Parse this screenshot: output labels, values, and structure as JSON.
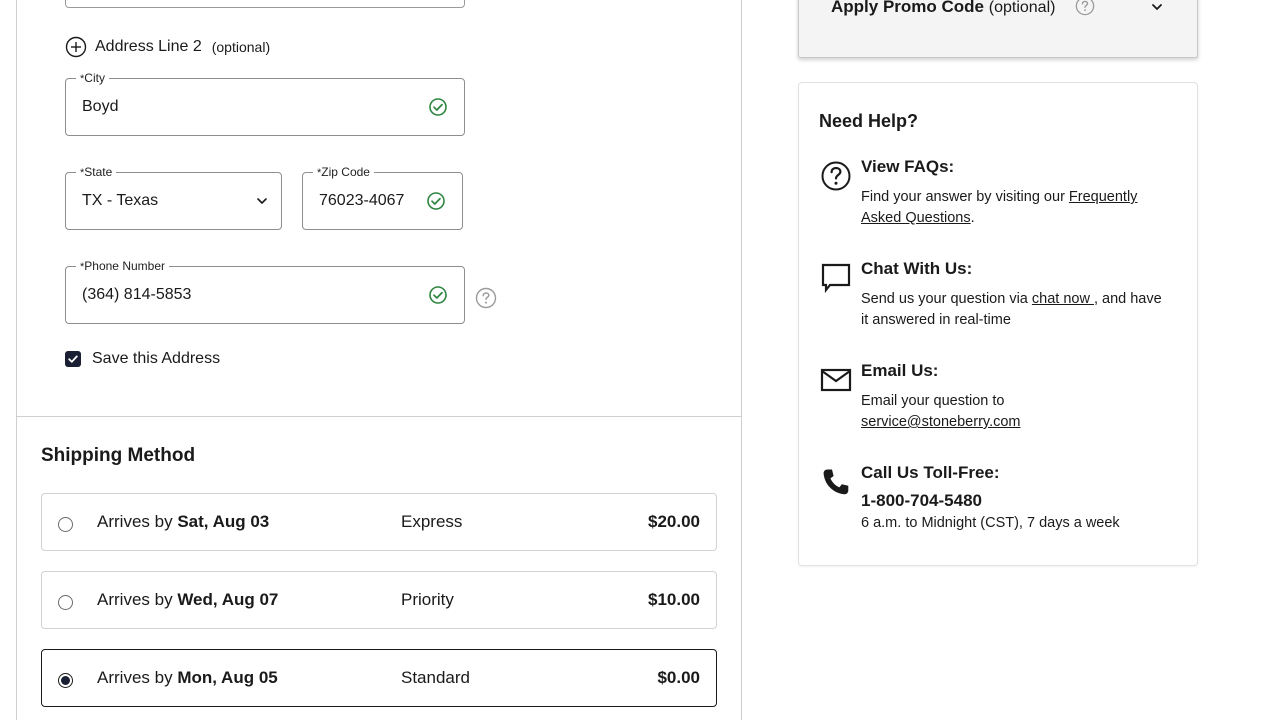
{
  "address_form": {
    "address_line2": {
      "label": "Address Line 2",
      "optional": "(optional)"
    },
    "city": {
      "label": "City",
      "required_mark": "*",
      "value": "Boyd"
    },
    "state": {
      "label": "State",
      "required_mark": "*",
      "value": "TX - Texas"
    },
    "zip": {
      "label": "Zip Code",
      "required_mark": "*",
      "value": "76023-4067"
    },
    "phone": {
      "label": "Phone Number",
      "required_mark": "*",
      "value": "(364) 814-5853"
    },
    "save_address": {
      "label": "Save this Address",
      "checked": true
    }
  },
  "shipping": {
    "title": "Shipping Method",
    "options": [
      {
        "prefix": "Arrives by",
        "date": "Sat, Aug 03",
        "method": "Express",
        "price": "$20.00",
        "selected": false
      },
      {
        "prefix": "Arrives by",
        "date": "Wed, Aug 07",
        "method": "Priority",
        "price": "$10.00",
        "selected": false
      },
      {
        "prefix": "Arrives by",
        "date": "Mon, Aug 05",
        "method": "Standard",
        "price": "$0.00",
        "selected": true
      }
    ]
  },
  "promo": {
    "title": "Apply Promo Code",
    "optional": "(optional)"
  },
  "help": {
    "title": "Need Help?",
    "faqs": {
      "heading": "View FAQs:",
      "text": "Find your answer by visiting our ",
      "link": "Frequently Asked Questions",
      "suffix": "."
    },
    "chat": {
      "heading": "Chat With Us:",
      "text": "Send us your question via ",
      "link": "chat now ",
      "suffix": ", and have it answered in real-time"
    },
    "email": {
      "heading": "Email Us:",
      "text": "Email your question to",
      "link": "service@stoneberry.com"
    },
    "call": {
      "heading": "Call Us Toll-Free:",
      "phone": "1-800-704-5480",
      "hours": "6 a.m. to Midnight (CST), 7 days a week"
    }
  },
  "colors": {
    "check_green": "#2e8540",
    "dark_navy": "#1b1f33",
    "border_gray": "#8e8e8e"
  },
  "icons": {
    "address_line2": "plus-circle-icon",
    "valid": "check-circle-icon",
    "select": "chevron-down-icon",
    "help": "question-circle-icon",
    "faqs": "question-circle-icon",
    "chat": "chat-bubble-icon",
    "email": "envelope-icon",
    "call": "phone-icon"
  }
}
